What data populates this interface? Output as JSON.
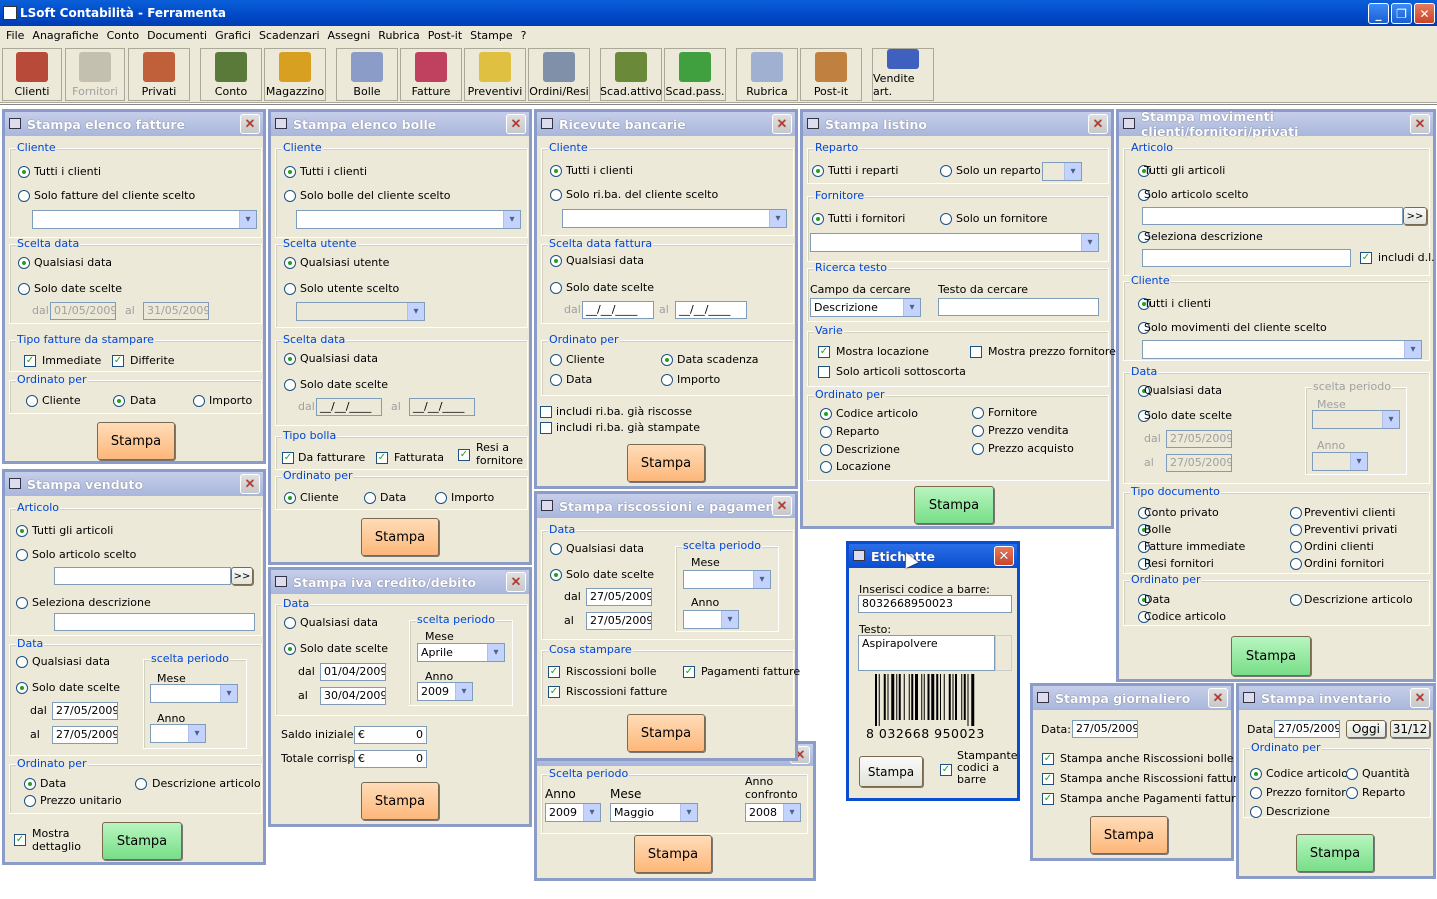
{
  "app": {
    "title": "LSoft Contabilità - Ferramenta",
    "min": "_",
    "max": "❐",
    "close": "✕"
  },
  "menu": [
    "File",
    "Anagrafiche",
    "Conto",
    "Documenti",
    "Grafici",
    "Scadenzari",
    "Assegni",
    "Rubrica",
    "Post-it",
    "Stampe",
    "?"
  ],
  "toolbar": [
    {
      "label": "Clienti",
      "icon": "clients-icon",
      "color": "#b84a3a"
    },
    {
      "label": "Fornitori",
      "icon": "suppliers-icon",
      "color": "#b0aa98"
    },
    {
      "label": "Privati",
      "icon": "people-icon",
      "color": "#c0603a"
    },
    {
      "label": "Conto",
      "icon": "cash-register-icon",
      "color": "#5a7a3a"
    },
    {
      "label": "Magazzino",
      "icon": "forklift-icon",
      "color": "#d8a020"
    },
    {
      "label": "Bolle",
      "icon": "document-icon",
      "color": "#8c9cc8"
    },
    {
      "label": "Fatture",
      "icon": "invoice-icon",
      "color": "#c04060"
    },
    {
      "label": "Preventivi",
      "icon": "pen-paper-icon",
      "color": "#e0c040"
    },
    {
      "label": "Ordini/Resi",
      "icon": "truck-icon",
      "color": "#8090a8"
    },
    {
      "label": "Scad.attivo",
      "icon": "money-in-icon",
      "color": "#6a8a3a"
    },
    {
      "label": "Scad.pass.",
      "icon": "money-out-icon",
      "color": "#40a040"
    },
    {
      "label": "Rubrica",
      "icon": "address-book-icon",
      "color": "#a0b0d0"
    },
    {
      "label": "Post-it",
      "icon": "note-icon",
      "color": "#c08040"
    },
    {
      "label": "Vendite art.",
      "icon": "chart-icon",
      "color": "#4060c0"
    }
  ],
  "w1": {
    "title": "Stampa elenco fatture",
    "cliente": "Cliente",
    "tutti": "Tutti i clienti",
    "solo": "Solo fatture del cliente scelto",
    "scelta": "Scelta data",
    "qual": "Qualsiasi data",
    "sds": "Solo date scelte",
    "dal": "dal",
    "al": "al",
    "d1": "01/05/2009",
    "d2": "31/05/2009",
    "tipo": "Tipo fatture da stampare",
    "imm": "Immediate",
    "diff": "Differite",
    "ord": "Ordinato per",
    "o1": "Cliente",
    "o2": "Data",
    "o3": "Importo",
    "btn": "Stampa"
  },
  "w2": {
    "title": "Stampa elenco bolle",
    "cliente": "Cliente",
    "tutti": "Tutti i clienti",
    "solo": "Solo bolle del cliente scelto",
    "su": "Scelta utente",
    "qu": "Qualsiasi utente",
    "sus": "Solo utente scelto",
    "sd": "Scelta data",
    "qd": "Qualsiasi data",
    "sds": "Solo date scelte",
    "dal": "dal",
    "al": "al",
    "d1": "__/__/____",
    "d2": "__/__/____",
    "tb": "Tipo bolla",
    "c1": "Da fatturare",
    "c2": "Fatturata",
    "c3": "Resi a fornitore",
    "ord": "Ordinato per",
    "o1": "Cliente",
    "o2": "Data",
    "o3": "Importo",
    "btn": "Stampa"
  },
  "w3": {
    "title": "Ricevute bancarie",
    "cliente": "Cliente",
    "tutti": "Tutti i clienti",
    "solo": "Solo ri.ba. del cliente scelto",
    "sd": "Scelta data fattura",
    "qd": "Qualsiasi data",
    "sds": "Solo date scelte",
    "dal": "dal",
    "al": "al",
    "d1": "__/__/____",
    "d2": "__/__/____",
    "ord": "Ordinato per",
    "o1": "Cliente",
    "o2": "Data scadenza",
    "o3": "Data",
    "o4": "Importo",
    "i1": "includi ri.ba. già riscosse",
    "i2": "includi ri.ba. già stampate",
    "btn": "Stampa"
  },
  "w4": {
    "title": "Stampa listino",
    "rep": "Reparto",
    "tr": "Tutti i reparti",
    "sr": "Solo un reparto",
    "forn": "Fornitore",
    "tf": "Tutti i fornitori",
    "sf": "Solo un fornitore",
    "rt": "Ricerca testo",
    "cdc": "Campo da cercare",
    "tdc": "Testo da cercare",
    "campo": "Descrizione",
    "varie": "Varie",
    "v1": "Mostra locazione",
    "v2": "Mostra prezzo fornitore",
    "v3": "Solo articoli sottoscorta",
    "ord": "Ordinato per",
    "o1": "Codice articolo",
    "o2": "Fornitore",
    "o3": "Reparto",
    "o4": "Prezzo vendita",
    "o5": "Descrizione",
    "o6": "Prezzo acquisto",
    "o7": "Locazione",
    "btn": "Stampa"
  },
  "w5": {
    "title": "Stampa movimenti clienti/fornitori/privati",
    "art": "Articolo",
    "ta": "Tutti gli articoli",
    "sa": "Solo articolo scelto",
    "sel": "Seleziona descrizione",
    "incl": "includi d.l.",
    "cl": "Cliente",
    "tc": "Tutti i clienti",
    "sm": "Solo movimenti del cliente scelto",
    "data": "Data",
    "qd": "Qualsiasi data",
    "sds": "Solo date scelte",
    "dal": "dal",
    "al": "al",
    "d1": "27/05/2009",
    "d2": "27/05/2009",
    "sp": "scelta periodo",
    "mese": "Mese",
    "anno": "Anno",
    "td": "Tipo documento",
    "t1": "Conto privato",
    "t2": "Preventivi clienti",
    "t3": "Bolle",
    "t4": "Preventivi privati",
    "t5": "Fatture immediate",
    "t6": "Ordini clienti",
    "t7": "Resi fornitori",
    "t8": "Ordini fornitori",
    "ord": "Ordinato per",
    "o1": "Data",
    "o2": "Descrizione articolo",
    "o3": "Codice articolo",
    "btn": "Stampa",
    "more": ">>"
  },
  "w6": {
    "title": "Stampa venduto",
    "art": "Articolo",
    "ta": "Tutti gli articoli",
    "sa": "Solo articolo scelto",
    "sel": "Seleziona descrizione",
    "data": "Data",
    "qd": "Qualsiasi data",
    "sds": "Solo date scelte",
    "dal": "dal",
    "al": "al",
    "d1": "27/05/2009",
    "d2": "27/05/2009",
    "sp": "scelta periodo",
    "mese": "Mese",
    "anno": "Anno",
    "ord": "Ordinato per",
    "o1": "Data",
    "o2": "Descrizione articolo",
    "o3": "Prezzo unitario",
    "md": "Mostra dettaglio",
    "btn": "Stampa",
    "more": ">>"
  },
  "w7": {
    "title": "Stampa iva credito/debito",
    "data": "Data",
    "qd": "Qualsiasi data",
    "sds": "Solo date scelte",
    "dal": "dal",
    "al": "al",
    "d1": "01/04/2009",
    "d2": "30/04/2009",
    "sp": "scelta periodo",
    "mese": "Mese",
    "mv": "Aprile",
    "anno": "Anno",
    "av": "2009",
    "si": "Saldo iniziale:",
    "tc": "Totale corrisp.:",
    "e1": "€",
    "v1": "0",
    "e2": "€",
    "v2": "0",
    "btn": "Stampa"
  },
  "w8": {
    "title": "Stampa riscossioni e pagamenti",
    "data": "Data",
    "qd": "Qualsiasi data",
    "sds": "Solo date scelte",
    "dal": "dal",
    "al": "al",
    "d1": "27/05/2009",
    "d2": "27/05/2009",
    "sp": "scelta periodo",
    "mese": "Mese",
    "anno": "Anno",
    "cs": "Cosa stampare",
    "c1": "Riscossioni bolle",
    "c2": "Pagamenti fatture",
    "c3": "Riscossioni fatture",
    "btn": "Stampa"
  },
  "w9": {
    "sp": "Scelta periodo",
    "anno": "Anno",
    "mese": "Mese",
    "ac": "Anno confronto",
    "av": "2009",
    "mv": "Maggio",
    "acv": "2008",
    "btn": "Stampa"
  },
  "w10": {
    "title": "Etichette",
    "ins": "Inserisci codice a barre:",
    "code": "8032668950023",
    "testo": "Testo:",
    "tv": "Aspirapolvere",
    "digits": "8 032668 950023",
    "btn": "Stampa",
    "stc": "Stampante codici a barre"
  },
  "w11": {
    "title": "Stampa giornaliero",
    "data": "Data:",
    "dv": "27/05/2009",
    "c1": "Stampa anche Riscossioni bolle",
    "c2": "Stampa anche Riscossioni fatture",
    "c3": "Stampa anche Pagamenti fatture",
    "btn": "Stampa"
  },
  "w12": {
    "title": "Stampa inventario",
    "data": "Data:",
    "dv": "27/05/2009",
    "oggi": "Oggi",
    "d3112": "31/12",
    "ord": "Ordinato per",
    "o1": "Codice articolo",
    "o2": "Quantità",
    "o3": "Prezzo fornitore",
    "o4": "Reparto",
    "o5": "Descrizione",
    "btn": "Stampa"
  }
}
